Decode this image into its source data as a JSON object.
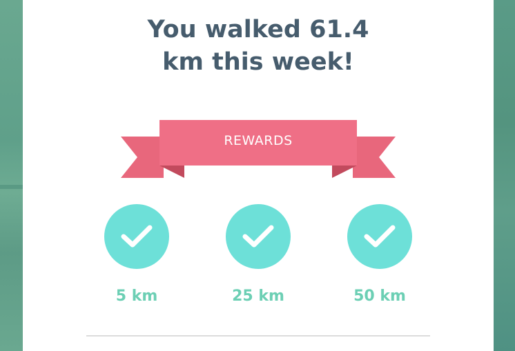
{
  "summary": {
    "title_line1": "You walked 61.4",
    "title_line2": "km this week!"
  },
  "banner": {
    "label": "REWARDS",
    "color": "#ef6f86"
  },
  "rewards": [
    {
      "label": "5 km",
      "icon": "check-icon",
      "achieved": true
    },
    {
      "label": "25 km",
      "icon": "check-icon",
      "achieved": true
    },
    {
      "label": "50 km",
      "icon": "check-icon",
      "achieved": true
    }
  ],
  "colors": {
    "title": "#465c6d",
    "reward_circle": "#6de0d8",
    "reward_label": "#6ccfb4"
  }
}
